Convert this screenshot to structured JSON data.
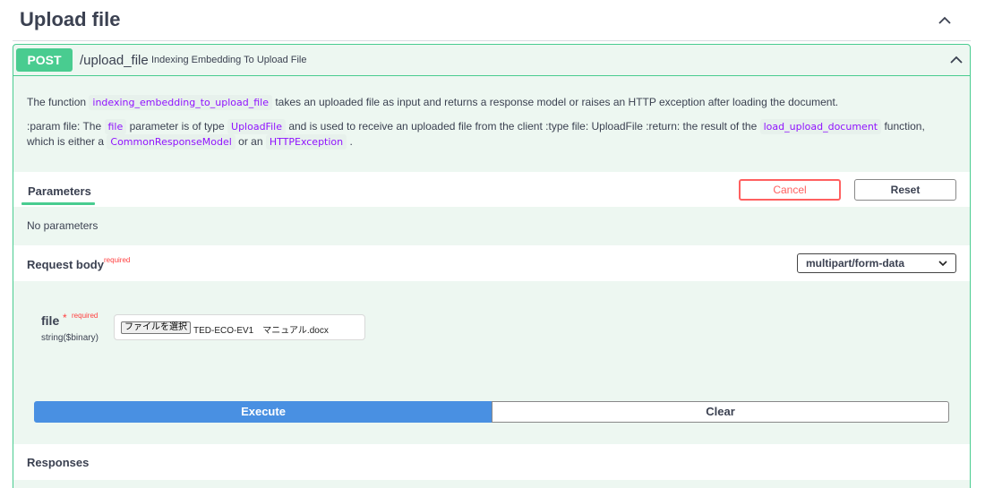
{
  "section": {
    "title": "Upload file",
    "collapse_icon": "chevron-up-icon"
  },
  "operation": {
    "method": "POST",
    "path": "/upload_file",
    "summary": "Indexing Embedding To Upload File",
    "collapse_icon": "chevron-up-icon",
    "colors": {
      "method_bg": "#49cc90",
      "panel_bg": "#edf7f1",
      "code_text": "#9012fe"
    }
  },
  "description": {
    "line1": {
      "pre": "The function",
      "code1": "indexing_embedding_to_upload_file",
      "post": "takes an uploaded file as input and returns a response model or raises an HTTP exception after loading the document."
    },
    "line2": {
      "t1": ":param file: The",
      "code1": "file",
      "t2": "parameter is of type",
      "code2": "UploadFile",
      "t3": "and is used to receive an uploaded file from the client :type file: UploadFile :return: the result of the",
      "code3": "load_upload_document",
      "t4": "function,"
    },
    "line3": {
      "t1": "which is either a",
      "code1": "CommonResponseModel",
      "t2": "or an",
      "code2": "HTTPException",
      "t3": "."
    }
  },
  "parameters": {
    "tab_label": "Parameters",
    "cancel_label": "Cancel",
    "reset_label": "Reset",
    "empty_text": "No parameters"
  },
  "request_body": {
    "label": "Request body",
    "required_label": "required",
    "content_type": "multipart/form-data",
    "field": {
      "name": "file",
      "star": "*",
      "required_label": "required",
      "type": "string($binary)",
      "choose_button": "ファイルを選択",
      "file_name": "TED-ECO-EV1　マニュアル.docx"
    }
  },
  "actions": {
    "execute_label": "Execute",
    "clear_label": "Clear"
  },
  "responses": {
    "label": "Responses"
  }
}
